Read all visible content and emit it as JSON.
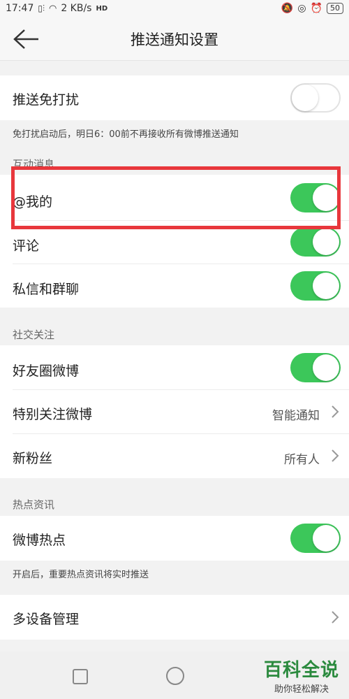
{
  "status_bar": {
    "time": "17:47",
    "network_speed": "2 KB/s",
    "hd_label": "HD",
    "battery": "50"
  },
  "header": {
    "title": "推送通知设置"
  },
  "dnd": {
    "label": "推送免打扰",
    "enabled": false,
    "note": "免打扰启动后，明日6：00前不再接收所有微博推送通知"
  },
  "section_interaction": {
    "title": "互动消息",
    "items": [
      {
        "label": "@我的",
        "enabled": true
      },
      {
        "label": "评论",
        "enabled": true
      },
      {
        "label": "私信和群聊",
        "enabled": true
      }
    ]
  },
  "section_social": {
    "title": "社交关注",
    "friends_weibo": {
      "label": "好友圈微博",
      "enabled": true
    },
    "special_follow": {
      "label": "特别关注微博",
      "value": "智能通知"
    },
    "new_fans": {
      "label": "新粉丝",
      "value": "所有人"
    }
  },
  "section_hot": {
    "title": "热点资讯",
    "hot_weibo": {
      "label": "微博热点",
      "enabled": true
    },
    "note": "开启后，重要热点资讯将实时推送"
  },
  "multi_device": {
    "label": "多设备管理"
  },
  "watermark": {
    "title": "百科全说",
    "subtitle": "助你轻松解决"
  },
  "colors": {
    "toggle_on": "#3cc75a",
    "highlight_border": "#e8373c"
  }
}
